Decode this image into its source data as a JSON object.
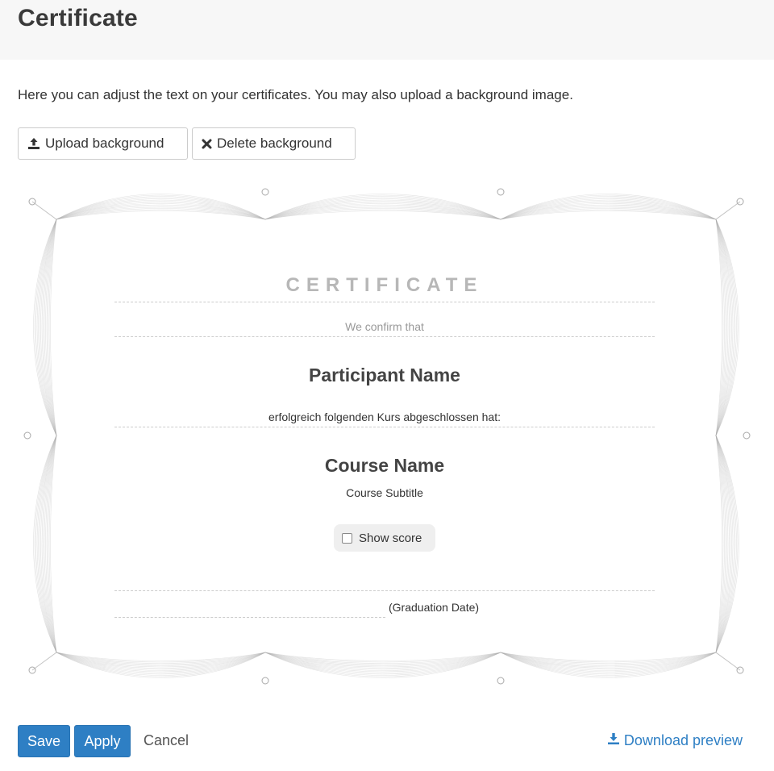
{
  "page": {
    "title": "Certificate"
  },
  "intro": "Here you can adjust the text on your certificates. You may also upload a background image.",
  "toolbar": {
    "upload_label": "Upload background",
    "upload_icon": "upload-icon",
    "delete_label": "Delete background",
    "delete_icon": "times-icon"
  },
  "certificate": {
    "title": "CERTIFICATE",
    "confirm": "We confirm that",
    "participant": "Participant Name",
    "completed": "erfolgreich folgenden Kurs abgeschlossen hat:",
    "course_name": "Course Name",
    "course_subtitle": "Course Subtitle",
    "show_score_label": "Show score",
    "show_score_checked": false,
    "graduation_date": "(Graduation Date)"
  },
  "footer": {
    "save_label": "Save",
    "apply_label": "Apply",
    "cancel_label": "Cancel",
    "download_label": "Download preview",
    "download_icon": "download-icon"
  },
  "colors": {
    "primary": "#2e7fc4",
    "header_bg": "#f7f7f7",
    "frame": "#a9a9a9"
  }
}
